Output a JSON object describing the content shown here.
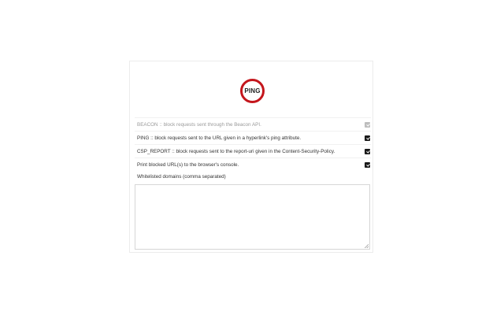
{
  "logo": {
    "text": "PING"
  },
  "options": [
    {
      "label": "BEACON :: block requests sent through the Beacon API.",
      "checked": true,
      "disabled": true
    },
    {
      "label": "PING :: block requests sent to the URL given in a hyperlink's ping attribute.",
      "checked": true,
      "disabled": false
    },
    {
      "label": "CSP_REPORT :: block requests sent to the report-uri given in the Content-Security-Policy.",
      "checked": true,
      "disabled": false
    },
    {
      "label": "Print blocked URL(s) to the browser's console.",
      "checked": true,
      "disabled": false
    }
  ],
  "whitelist": {
    "label": "Whitelisted domains (comma separated)",
    "value": ""
  },
  "colors": {
    "logo_ring": "#c4161c",
    "checkbox": "#1a1a1a",
    "checkbox_disabled": "#bdbdbd"
  },
  "icons": {
    "logo": "ping-logo-icon",
    "resize": "resize-grip-icon"
  }
}
